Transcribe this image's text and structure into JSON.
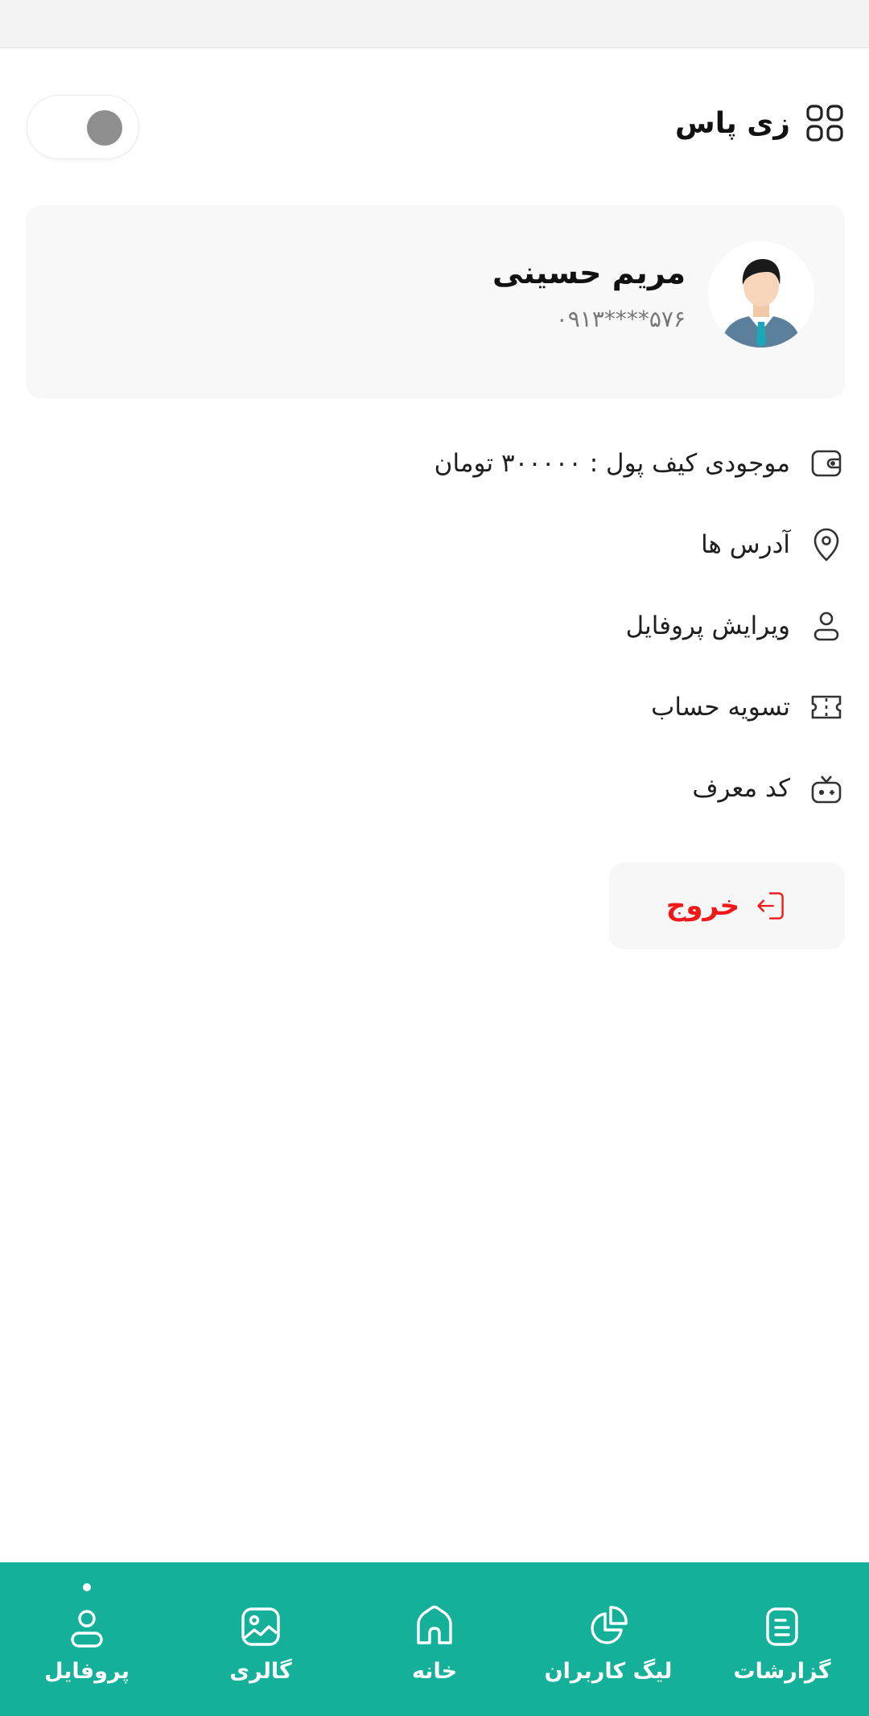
{
  "header": {
    "title": "زی پاس",
    "brand_icon": "grid-icon",
    "theme_toggle_state": "off"
  },
  "profile": {
    "name": "مریم حسینی",
    "phone": "۰۹۱۳****۵۷۶",
    "avatar_icon": "user-avatar"
  },
  "menu": {
    "items": [
      {
        "label": "موجودی کیف پول : ۳۰۰۰۰۰ تومان",
        "icon": "wallet-icon"
      },
      {
        "label": "آدرس ها",
        "icon": "location-pin-icon"
      },
      {
        "label": "ویرایش پروفایل",
        "icon": "user-icon"
      },
      {
        "label": "تسویه حساب",
        "icon": "ticket-icon"
      },
      {
        "label": "کد معرف",
        "icon": "gift-icon"
      }
    ]
  },
  "logout": {
    "label": "خروج",
    "icon": "logout-icon",
    "color": "#f01818"
  },
  "bottom_nav": {
    "background": "#14b09a",
    "items": [
      {
        "label": "گزارشات",
        "icon": "report-icon"
      },
      {
        "label": "لیگ کاربران",
        "icon": "pie-chart-icon"
      },
      {
        "label": "خانه",
        "icon": "home-icon"
      },
      {
        "label": "گالری",
        "icon": "gallery-icon"
      },
      {
        "label": "پروفایل",
        "icon": "profile-icon",
        "active": true
      }
    ]
  }
}
